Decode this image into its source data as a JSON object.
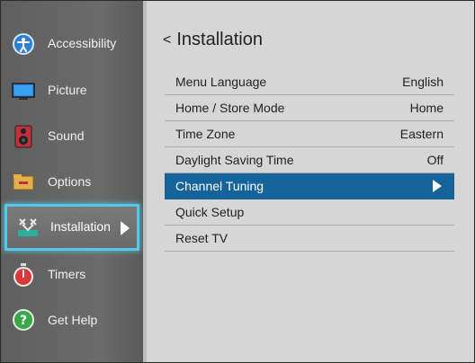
{
  "sidebar": {
    "items": [
      {
        "label": "Accessibility",
        "icon": "accessibility-icon"
      },
      {
        "label": "Picture",
        "icon": "monitor-icon"
      },
      {
        "label": "Sound",
        "icon": "speaker-icon"
      },
      {
        "label": "Options",
        "icon": "options-folder-icon"
      },
      {
        "label": "Installation",
        "icon": "satellite-dish-icon",
        "selected": true
      },
      {
        "label": "Timers",
        "icon": "stopwatch-icon"
      },
      {
        "label": "Get Help",
        "icon": "help-icon"
      }
    ]
  },
  "main": {
    "back_symbol": "<",
    "title": "Installation",
    "rows": [
      {
        "label": "Menu Language",
        "value": "English"
      },
      {
        "label": "Home / Store Mode",
        "value": "Home"
      },
      {
        "label": "Time Zone",
        "value": "Eastern"
      },
      {
        "label": "Daylight Saving Time",
        "value": "Off"
      },
      {
        "label": "Channel Tuning",
        "value": "",
        "highlighted": true
      },
      {
        "label": "Quick Setup",
        "value": ""
      },
      {
        "label": "Reset TV",
        "value": ""
      }
    ]
  },
  "colors": {
    "selection_border": "#53c8e8",
    "row_highlight": "#14639b"
  }
}
